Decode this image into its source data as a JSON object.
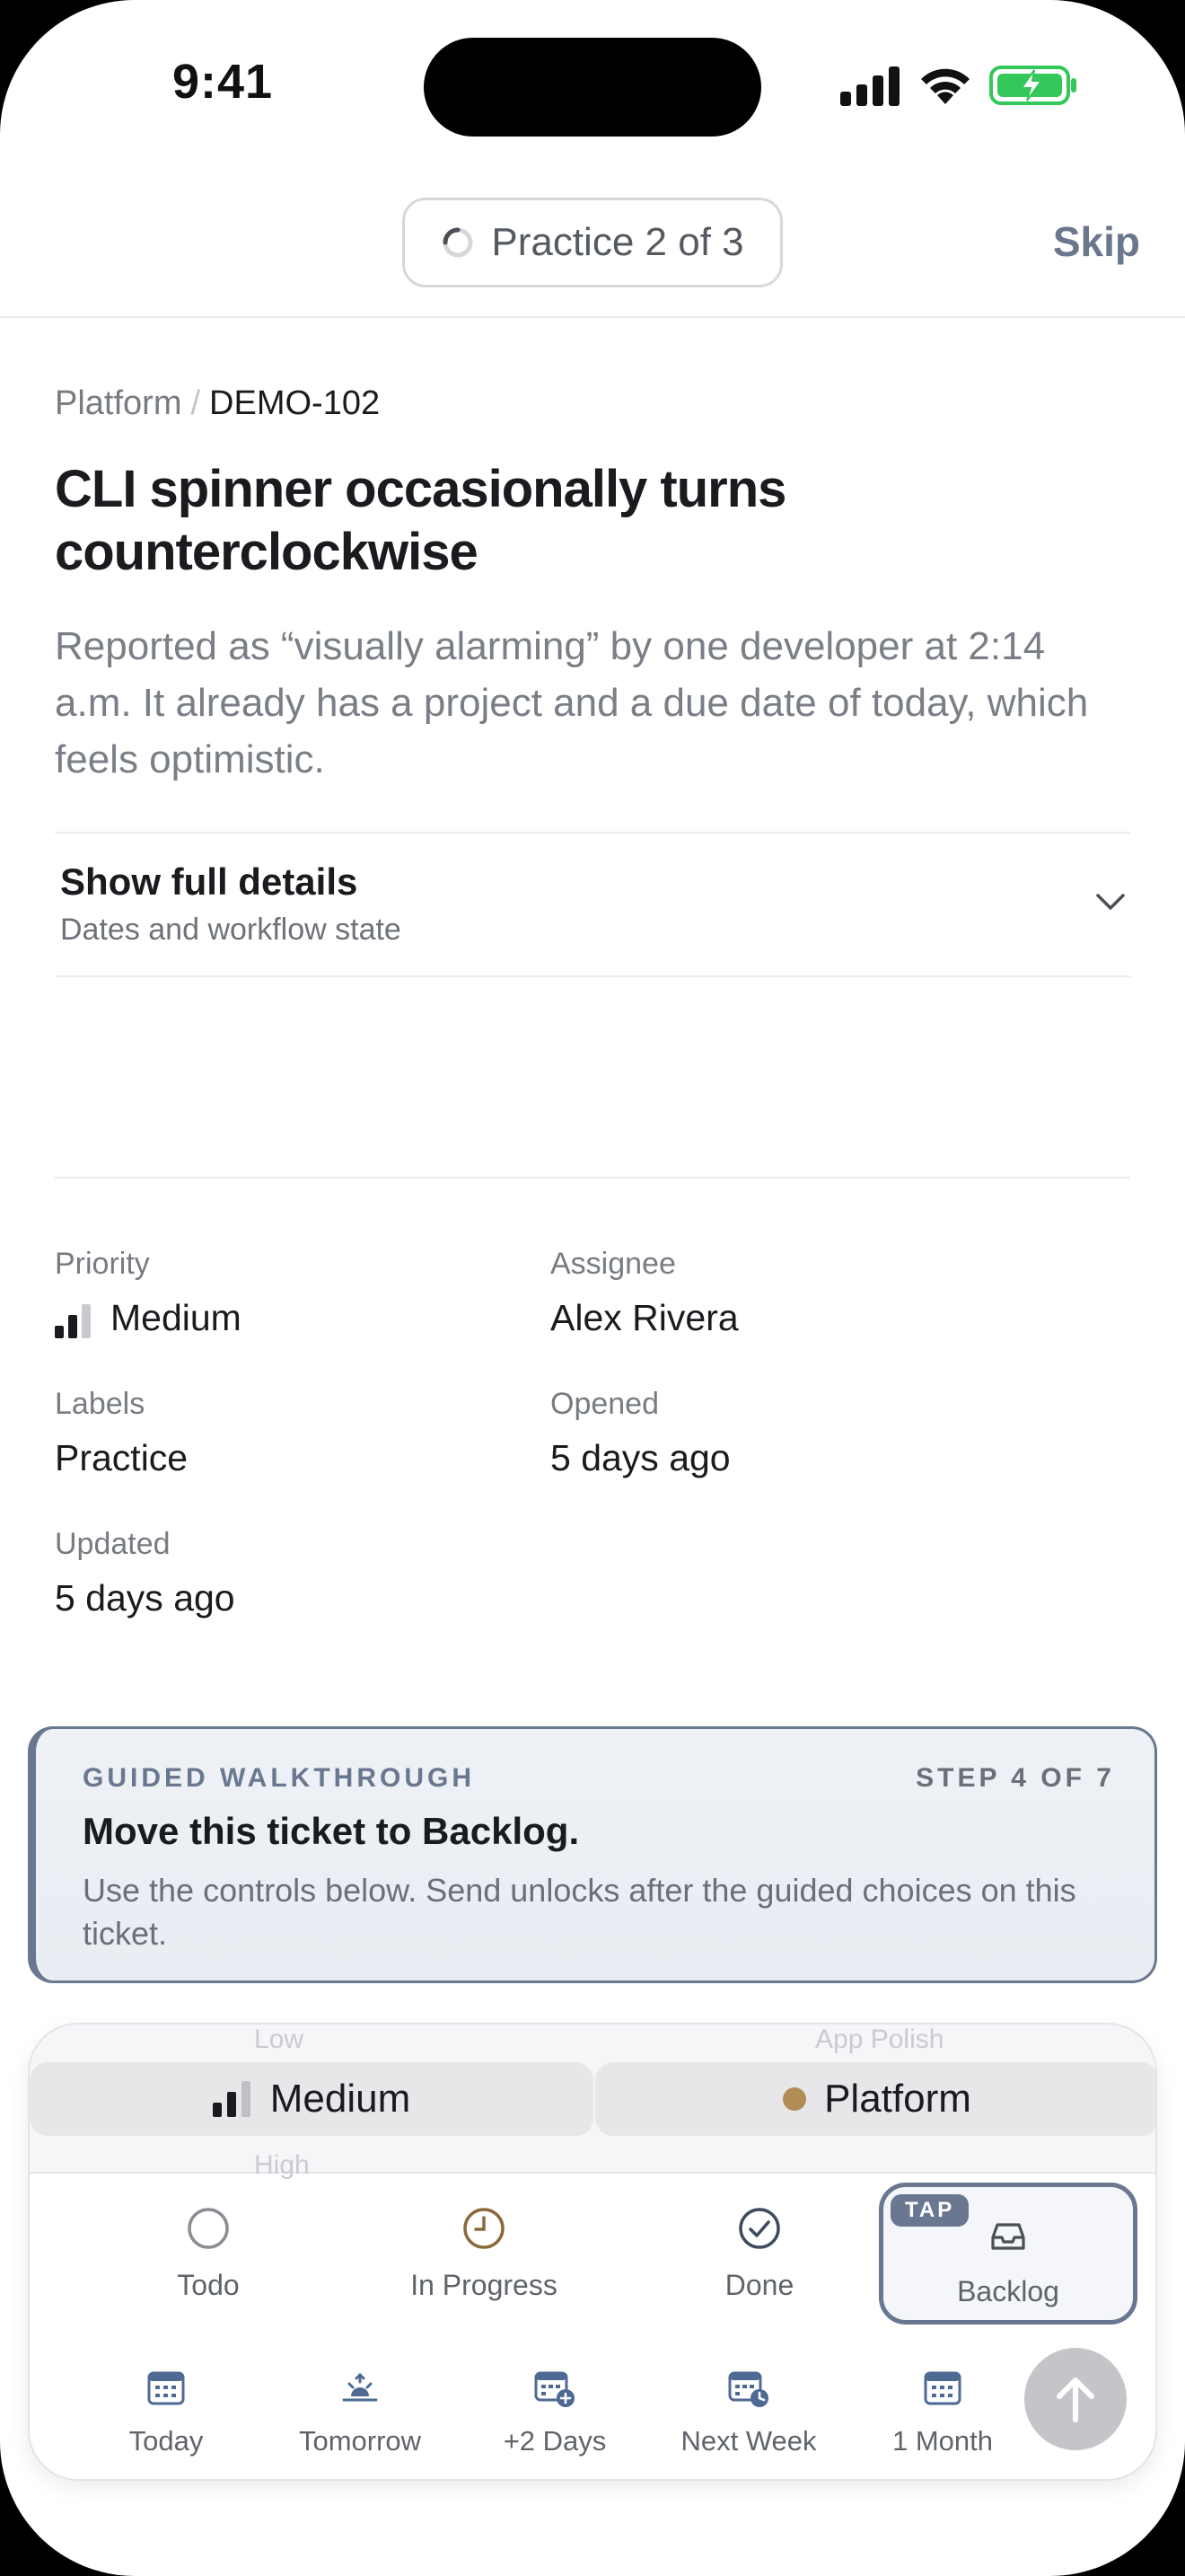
{
  "status_bar": {
    "time": "9:41"
  },
  "header": {
    "practice_label": "Practice 2 of 3",
    "skip_label": "Skip"
  },
  "ticket": {
    "project": "Platform",
    "separator": "/",
    "id": "DEMO-102",
    "title": "CLI spinner occasionally turns counterclockwise",
    "description": "Reported as “visually alarming” by one developer at 2:14 a.m. It already has a project and a due date of today, which feels optimistic."
  },
  "details_toggle": {
    "title": "Show full details",
    "subtitle": "Dates and workflow state"
  },
  "meta": {
    "priority_label": "Priority",
    "priority_value": "Medium",
    "assignee_label": "Assignee",
    "assignee_value": "Alex Rivera",
    "labels_label": "Labels",
    "labels_value": "Practice",
    "opened_label": "Opened",
    "opened_value": "5 days ago",
    "updated_label": "Updated",
    "updated_value": "5 days ago"
  },
  "guide": {
    "kicker": "GUIDED WALKTHROUGH",
    "step": "STEP 4 OF 7",
    "headline": "Move this ticket to Backlog.",
    "body": "Use the controls below. Send unlocks after the guided choices on this ticket."
  },
  "pickers": {
    "priority_above": "Low",
    "priority_selected": "Medium",
    "priority_below": "High",
    "project_above": "App Polish",
    "project_selected": "Platform",
    "project_color": "#b08d57"
  },
  "status_options": [
    {
      "label": "Todo",
      "icon": "circle-icon"
    },
    {
      "label": "In Progress",
      "icon": "clock-icon"
    },
    {
      "label": "Done",
      "icon": "check-circle-icon"
    },
    {
      "label": "Backlog",
      "icon": "inbox-icon",
      "badge": "TAP"
    }
  ],
  "date_options": [
    {
      "label": "Today",
      "icon": "calendar-icon"
    },
    {
      "label": "Tomorrow",
      "icon": "sunrise-icon"
    },
    {
      "label": "+2 Days",
      "icon": "calendar-plus-icon"
    },
    {
      "label": "Next Week",
      "icon": "calendar-clock-icon"
    },
    {
      "label": "1 Month",
      "icon": "calendar-icon"
    }
  ],
  "send": {
    "icon": "arrow-up-icon"
  },
  "colors": {
    "accent": "#6a7790",
    "project_dot": "#b08d57",
    "battery": "#34c759"
  }
}
